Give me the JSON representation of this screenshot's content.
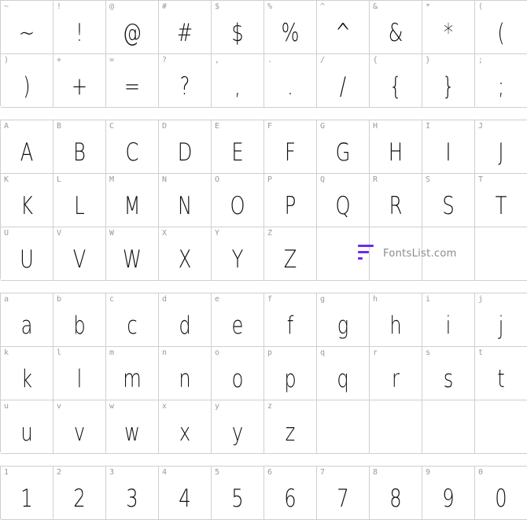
{
  "symbols": [
    {
      "label": "~",
      "glyph": "~"
    },
    {
      "label": "!",
      "glyph": "!"
    },
    {
      "label": "@",
      "glyph": "@"
    },
    {
      "label": "#",
      "glyph": "#"
    },
    {
      "label": "$",
      "glyph": "$"
    },
    {
      "label": "%",
      "glyph": "%"
    },
    {
      "label": "^",
      "glyph": "^"
    },
    {
      "label": "&",
      "glyph": "&"
    },
    {
      "label": "*",
      "glyph": "*"
    },
    {
      "label": "(",
      "glyph": "("
    },
    {
      "label": ")",
      "glyph": ")"
    },
    {
      "label": "+",
      "glyph": "+"
    },
    {
      "label": "=",
      "glyph": "="
    },
    {
      "label": "?",
      "glyph": "?"
    },
    {
      "label": ",",
      "glyph": ","
    },
    {
      "label": ".",
      "glyph": "."
    },
    {
      "label": "/",
      "glyph": "/"
    },
    {
      "label": "{",
      "glyph": "{"
    },
    {
      "label": "}",
      "glyph": "}"
    },
    {
      "label": ";",
      "glyph": ";"
    }
  ],
  "uppercase": [
    {
      "label": "A",
      "glyph": "A"
    },
    {
      "label": "B",
      "glyph": "B"
    },
    {
      "label": "C",
      "glyph": "C"
    },
    {
      "label": "D",
      "glyph": "D"
    },
    {
      "label": "E",
      "glyph": "E"
    },
    {
      "label": "F",
      "glyph": "F"
    },
    {
      "label": "G",
      "glyph": "G"
    },
    {
      "label": "H",
      "glyph": "H"
    },
    {
      "label": "I",
      "glyph": "I"
    },
    {
      "label": "J",
      "glyph": "J"
    },
    {
      "label": "K",
      "glyph": "K"
    },
    {
      "label": "L",
      "glyph": "L"
    },
    {
      "label": "M",
      "glyph": "M"
    },
    {
      "label": "N",
      "glyph": "N"
    },
    {
      "label": "O",
      "glyph": "O"
    },
    {
      "label": "P",
      "glyph": "P"
    },
    {
      "label": "Q",
      "glyph": "Q"
    },
    {
      "label": "R",
      "glyph": "R"
    },
    {
      "label": "S",
      "glyph": "S"
    },
    {
      "label": "T",
      "glyph": "T"
    },
    {
      "label": "U",
      "glyph": "U"
    },
    {
      "label": "V",
      "glyph": "V"
    },
    {
      "label": "W",
      "glyph": "W"
    },
    {
      "label": "X",
      "glyph": "X"
    },
    {
      "label": "Y",
      "glyph": "Y"
    },
    {
      "label": "Z",
      "glyph": "Z"
    }
  ],
  "lowercase": [
    {
      "label": "a",
      "glyph": "a"
    },
    {
      "label": "b",
      "glyph": "b"
    },
    {
      "label": "c",
      "glyph": "c"
    },
    {
      "label": "d",
      "glyph": "d"
    },
    {
      "label": "e",
      "glyph": "e"
    },
    {
      "label": "f",
      "glyph": "f"
    },
    {
      "label": "g",
      "glyph": "g"
    },
    {
      "label": "h",
      "glyph": "h"
    },
    {
      "label": "i",
      "glyph": "i"
    },
    {
      "label": "j",
      "glyph": "j"
    },
    {
      "label": "k",
      "glyph": "k"
    },
    {
      "label": "l",
      "glyph": "l"
    },
    {
      "label": "m",
      "glyph": "m"
    },
    {
      "label": "n",
      "glyph": "n"
    },
    {
      "label": "o",
      "glyph": "o"
    },
    {
      "label": "p",
      "glyph": "p"
    },
    {
      "label": "q",
      "glyph": "q"
    },
    {
      "label": "r",
      "glyph": "r"
    },
    {
      "label": "s",
      "glyph": "s"
    },
    {
      "label": "t",
      "glyph": "t"
    },
    {
      "label": "u",
      "glyph": "u"
    },
    {
      "label": "v",
      "glyph": "v"
    },
    {
      "label": "w",
      "glyph": "w"
    },
    {
      "label": "x",
      "glyph": "x"
    },
    {
      "label": "y",
      "glyph": "y"
    },
    {
      "label": "z",
      "glyph": "z"
    }
  ],
  "digits": [
    {
      "label": "1",
      "glyph": "1"
    },
    {
      "label": "2",
      "glyph": "2"
    },
    {
      "label": "3",
      "glyph": "3"
    },
    {
      "label": "4",
      "glyph": "4"
    },
    {
      "label": "5",
      "glyph": "5"
    },
    {
      "label": "6",
      "glyph": "6"
    },
    {
      "label": "7",
      "glyph": "7"
    },
    {
      "label": "8",
      "glyph": "8"
    },
    {
      "label": "9",
      "glyph": "9"
    },
    {
      "label": "0",
      "glyph": "0"
    }
  ],
  "watermark": {
    "text": "FontsList.com",
    "color": "#6a2cf0"
  }
}
